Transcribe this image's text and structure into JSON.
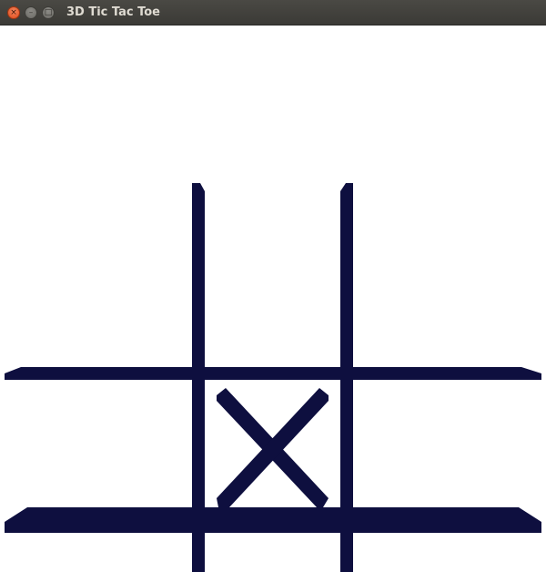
{
  "window": {
    "title": "3D Tic Tac Toe",
    "close_glyph": "×",
    "minimize_glyph": "–",
    "maximize_glyph": "□"
  },
  "colors": {
    "board": "#0e0f3f",
    "background": "#ffffff"
  },
  "board": {
    "rows": 3,
    "cols": 3,
    "cells": [
      "",
      "",
      "",
      "",
      "",
      "",
      "",
      "X",
      ""
    ]
  }
}
